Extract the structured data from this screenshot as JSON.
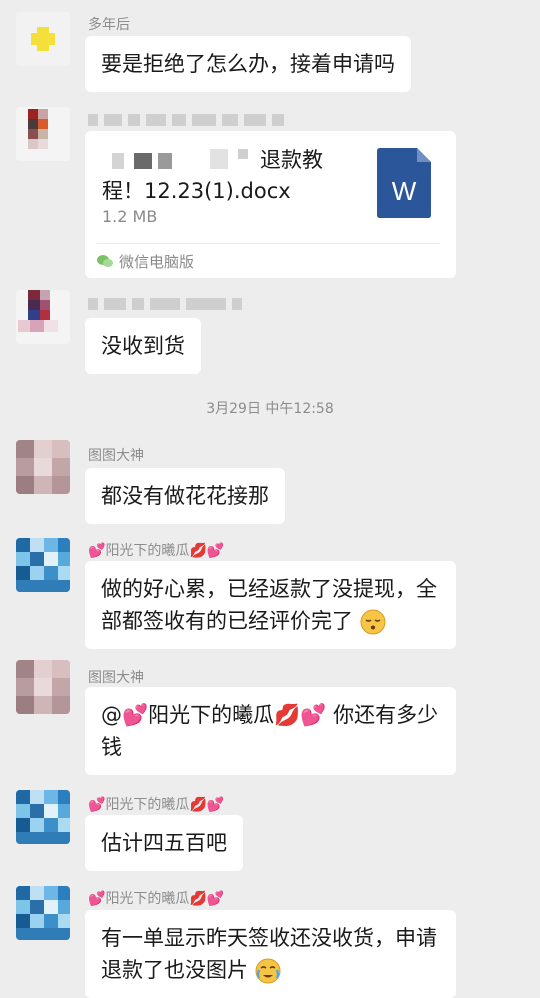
{
  "messages": [
    {
      "name": "多年后",
      "text": "要是拒绝了怎么办，接着申请吗"
    },
    {
      "name": "",
      "file": {
        "title": "退款教程！12.23(1).docx",
        "title_visible_line1": "退款教",
        "title_visible_line2": "程！12.23(1).docx",
        "size": "1.2 MB",
        "source": "微信电脑版",
        "icon_letter": "W"
      }
    },
    {
      "name": "",
      "text": "没收到货"
    },
    {
      "name": "图图大神",
      "text": "都没有做花花接那"
    },
    {
      "name": "阳光下的曦瓜",
      "text": "做的好心累，已经返款了没提现，全部都签收有的已经评价完了"
    },
    {
      "name": "图图大神",
      "mention": "@💕阳光下的曦瓜💋💕",
      "text": " 你还有多少钱"
    },
    {
      "name": "阳光下的曦瓜",
      "text": "估计四五百吧"
    },
    {
      "name": "阳光下的曦瓜",
      "text": "有一单显示昨天签收还没收货，申请退款了也没图片"
    }
  ],
  "time_separator": "3月29日 中午12:58",
  "colors": {
    "background": "#ededed",
    "bubble": "#ffffff",
    "name": "#8c8c8c",
    "word_blue": "#2b579a"
  }
}
